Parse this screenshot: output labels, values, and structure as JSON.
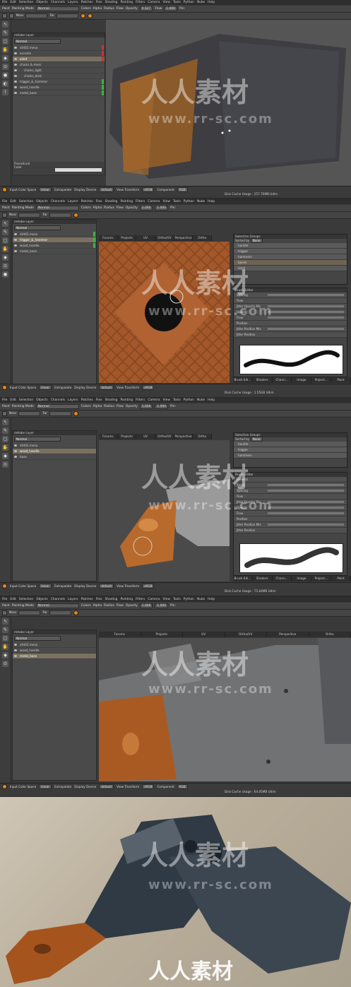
{
  "menu": [
    "File",
    "Edit",
    "Selection",
    "Objects",
    "Channels",
    "Layers",
    "Patches",
    "Flex",
    "Shading",
    "Painting",
    "Filters",
    "Camera",
    "View",
    "Tools",
    "Python",
    "Nuke",
    "Help"
  ],
  "toolbar1": {
    "paint": "Paint",
    "painting_mode_label": "Painting Mode",
    "painting_mode": "Normal",
    "colors": "Colors",
    "alpha": "Alpha",
    "radius": "Radius",
    "flow": "Flow",
    "opacity": "Opacity",
    "pin": "Pin:"
  },
  "toolbar2": {
    "near": "Near",
    "far": "Far"
  },
  "tabs": [
    "Forums",
    "Projects",
    "UV",
    "Ortho/UV",
    "Perspective",
    "Ortho"
  ],
  "layers_title": "mHabe Layer",
  "blend_mode": "Normal",
  "panels": [
    {
      "layers": [
        "dirt02.mesa",
        "accents",
        "oiled",
        "chains & mess",
        "chains_light",
        "chains_dark",
        "trigger_&_hammer",
        "wood_handle",
        "metal_base"
      ],
      "selected": 2,
      "opacity": "0.527",
      "flow": "1.000",
      "cache": "Disk Cache Usage : 257.70MB Udim"
    },
    {
      "layers": [
        "dirt02.mesa",
        "trigger_&_hammer",
        "wood_handle",
        "metal_base"
      ],
      "selected": 1,
      "opacity": "1.000",
      "flow": "1.000",
      "cache": "Disk Cache Usage : 1.55GB Udim"
    },
    {
      "layers": [
        "dirt02.mesa",
        "wood_handle",
        "base"
      ],
      "selected": 1,
      "opacity": "1.000",
      "flow": "1.000",
      "cache": "Disk Cache Usage : 75.64MB Udim"
    },
    {
      "layers": [
        "dirt02.mesa",
        "wood_handle",
        "metal_base"
      ],
      "selected": 2,
      "opacity": "1.000",
      "flow": "1.000",
      "cache": "Disk Cache Usage : 64.05MB Udim"
    }
  ],
  "procedural": {
    "title": "Procedural",
    "color": "Color"
  },
  "status": {
    "input_color_space": "Input Color Space",
    "linear": "linear",
    "extrapolate": "Extrapolate",
    "display_device": "Display Device",
    "default": "default",
    "view_transform": "View Transform",
    "srgb": "sRGB",
    "component": "Component",
    "rgb": "RGB"
  },
  "selection_groups": {
    "title": "Selection Groups",
    "sorted_by": "Sorted by",
    "none": "None",
    "items_a": [
      "handle",
      "trigger",
      "hammers",
      "barrel",
      "latch"
    ],
    "items_b": [
      "handle",
      "trigger",
      "hammers"
    ]
  },
  "brush_editor": {
    "title": "Brush Editor",
    "rows_a": [
      "Spacing",
      "Flow",
      "Jitter Opacity Mix",
      "Opacity",
      "Flow",
      "Position",
      "Jitter Position Mix",
      "Jitter Position"
    ],
    "rows_b": [
      "General",
      "Angle",
      "Spacing",
      "Flow",
      "Jitter Opacity Mix",
      "Opacity",
      "Flow",
      "Position",
      "Jitter Position Mix",
      "Jitter Position"
    ]
  },
  "bottom_tabs": [
    "Brush Edi...",
    "Shaders",
    "Chann...",
    "Image Mana...",
    "Project...",
    "Paint"
  ],
  "watermark": {
    "brand": "人人素材",
    "url": "www.rr-sc.com"
  },
  "colors": {
    "accent": "#e8861a",
    "wood": "#b5652a",
    "ui": "#3a3a3a"
  }
}
